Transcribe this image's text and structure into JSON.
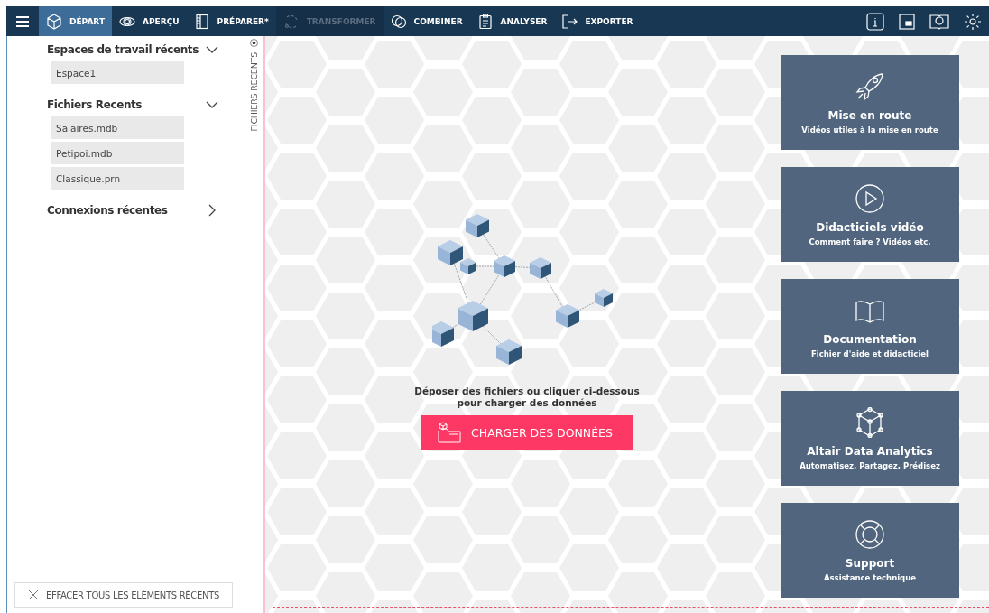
{
  "toolbar": {
    "tabs": [
      {
        "label": "DÉPART",
        "selected": true,
        "disabled": false
      },
      {
        "label": "APERÇU",
        "selected": false,
        "disabled": false
      },
      {
        "label": "PRÉPARER*",
        "selected": false,
        "disabled": false
      },
      {
        "label": "TRANSFORMER",
        "selected": false,
        "disabled": true
      },
      {
        "label": "COMBINER",
        "selected": false,
        "disabled": false
      },
      {
        "label": "ANALYSER",
        "selected": false,
        "disabled": false
      },
      {
        "label": "EXPORTER",
        "selected": false,
        "disabled": false
      }
    ]
  },
  "sidebar": {
    "sections": [
      {
        "title": "Espaces de travail récents",
        "expanded": true,
        "items": [
          "Espace1"
        ]
      },
      {
        "title": "Fichiers Recents",
        "expanded": true,
        "items": [
          "Salaires.mdb",
          "Petipoi.mdb",
          "Classique.prn"
        ]
      },
      {
        "title": "Connexions récentes",
        "expanded": false
      }
    ],
    "clear_button": "EFFACER TOUS LES ÉLÉMENTS RÉCENTS"
  },
  "side_tab": {
    "label": "FICHIERS RECENTS"
  },
  "drop_zone": {
    "instruction": "Déposer des fichiers ou cliquer ci-dessous pour charger des données",
    "button": "CHARGER DES DONNÉES"
  },
  "cards": [
    {
      "title": "Mise en route",
      "subtitle": "Vidéos utiles à la mise en route"
    },
    {
      "title": "Didacticiels vidéo",
      "subtitle": "Comment faire ? Vidéos etc."
    },
    {
      "title": "Documentation",
      "subtitle": "Fichier d'aide et didacticiel"
    },
    {
      "title": "Altair Data Analytics",
      "subtitle": "Automatisez, Partagez, Prédisez"
    },
    {
      "title": "Support",
      "subtitle": "Assistance technique"
    }
  ]
}
